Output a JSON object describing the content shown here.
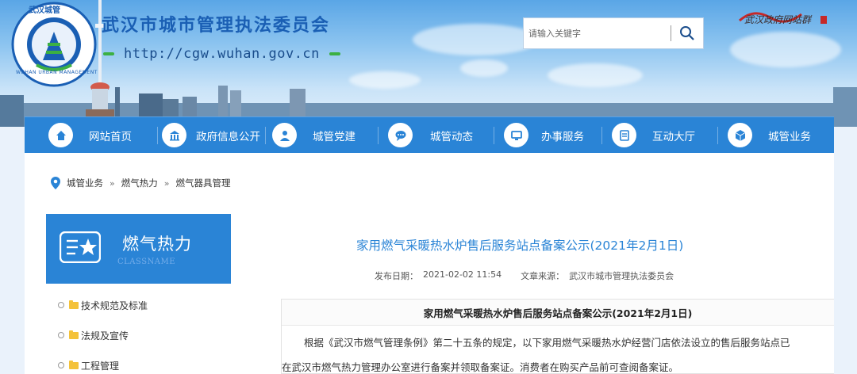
{
  "header": {
    "site_name": "武汉市城市管理执法委员会",
    "site_url": "http://cgw.wuhan.gov.cn",
    "logo_text": "武汉城管",
    "logo_en": "WUHAN URBAN MANAGEMENT",
    "wordmark": "武汉政府网站群"
  },
  "search": {
    "placeholder": "请输入关键字"
  },
  "nav": {
    "items": [
      {
        "label": "网站首页",
        "icon": "home-icon"
      },
      {
        "label": "政府信息公开",
        "icon": "building-icon"
      },
      {
        "label": "城管党建",
        "icon": "person-icon"
      },
      {
        "label": "城管动态",
        "icon": "chat-icon"
      },
      {
        "label": "办事服务",
        "icon": "monitor-icon"
      },
      {
        "label": "互动大厅",
        "icon": "list-icon"
      },
      {
        "label": "城管业务",
        "icon": "cube-icon"
      }
    ]
  },
  "breadcrumb": {
    "items": [
      "城管业务",
      "燃气热力",
      "燃气器具管理"
    ],
    "separator": "»"
  },
  "sidebar": {
    "title": "燃气热力",
    "subtitle": "CLASSNAME",
    "items": [
      "技术规范及标准",
      "法规及宣传",
      "工程管理"
    ]
  },
  "article": {
    "title": "家用燃气采暖热水炉售后服务站点备案公示(2021年2月1日)",
    "date_label": "发布日期：",
    "date": "2021-02-02 11:54",
    "source_label": "文章来源：",
    "source": "武汉市城市管理执法委员会",
    "subtitle": "家用燃气采暖热水炉售后服务站点备案公示(2021年2月1日)",
    "paragraph1": "根据《武汉市燃气管理条例》第二十五条的规定，以下家用燃气采暖热水炉经营门店依法设立的售后服务站点已",
    "paragraph2": "在武汉市燃气热力管理办公室进行备案并领取备案证。消费者在购买产品前可查阅备案证。"
  },
  "colors": {
    "nav_blue": "#2a84d6",
    "title_blue": "#1a5fb4",
    "url_dash_green": "#3cb043"
  }
}
